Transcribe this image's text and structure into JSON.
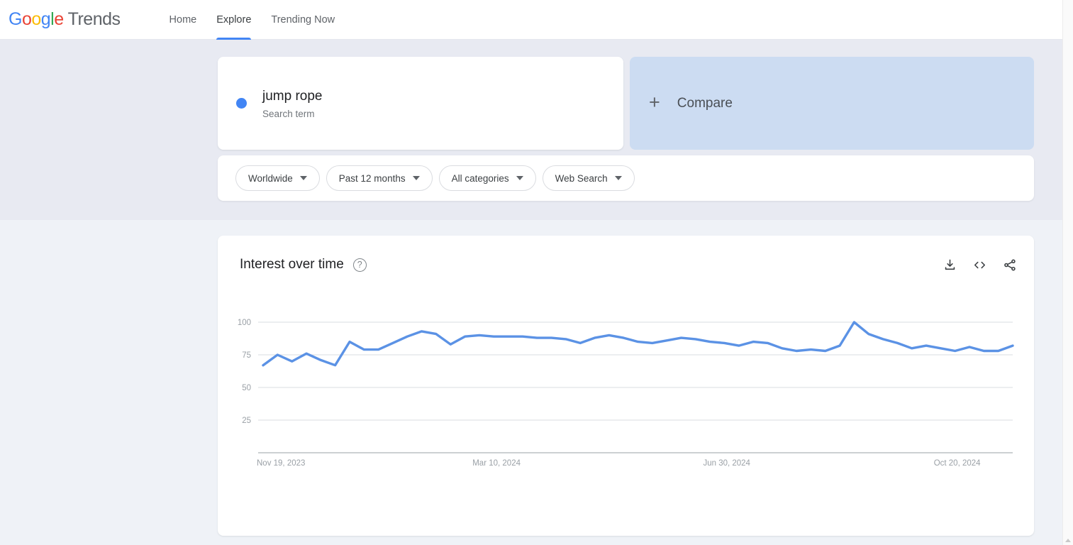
{
  "nav": {
    "brand_letters": [
      "G",
      "o",
      "o",
      "g",
      "l",
      "e"
    ],
    "brand_word": "Trends",
    "items": [
      {
        "label": "Home",
        "active": false
      },
      {
        "label": "Explore",
        "active": true
      },
      {
        "label": "Trending Now",
        "active": false
      }
    ]
  },
  "query": {
    "term": "jump rope",
    "term_type": "Search term",
    "term_color": "#4285F4",
    "compare_label": "Compare",
    "compare_plus": "+"
  },
  "filters": [
    {
      "label": "Worldwide"
    },
    {
      "label": "Past 12 months"
    },
    {
      "label": "All categories"
    },
    {
      "label": "Web Search"
    }
  ],
  "chart_card": {
    "title": "Interest over time",
    "help_glyph": "?",
    "actions": [
      {
        "name": "download-icon"
      },
      {
        "name": "embed-icon"
      },
      {
        "name": "share-icon"
      }
    ]
  },
  "chart_data": {
    "type": "line",
    "title": "Interest over time",
    "xlabel": "",
    "ylabel": "",
    "ylim": [
      0,
      108
    ],
    "yticks": [
      25,
      50,
      75,
      100
    ],
    "grid": true,
    "legend": false,
    "line_color": "#5b92e5",
    "xtick_labels": [
      "Nov 19, 2023",
      "Mar 10, 2024",
      "Jun 30, 2024",
      "Oct 20, 2024"
    ],
    "xtick_indices": [
      0,
      16,
      32,
      48
    ],
    "series": [
      {
        "name": "jump rope",
        "color": "#5b92e5",
        "values": [
          67,
          75,
          70,
          76,
          71,
          67,
          85,
          79,
          79,
          84,
          89,
          93,
          91,
          83,
          89,
          90,
          89,
          89,
          89,
          88,
          88,
          87,
          84,
          88,
          90,
          88,
          85,
          84,
          86,
          88,
          87,
          85,
          84,
          82,
          85,
          84,
          80,
          78,
          79,
          78,
          82,
          100,
          91,
          87,
          84,
          80,
          82,
          80,
          78,
          81,
          78,
          78,
          82
        ]
      }
    ]
  }
}
